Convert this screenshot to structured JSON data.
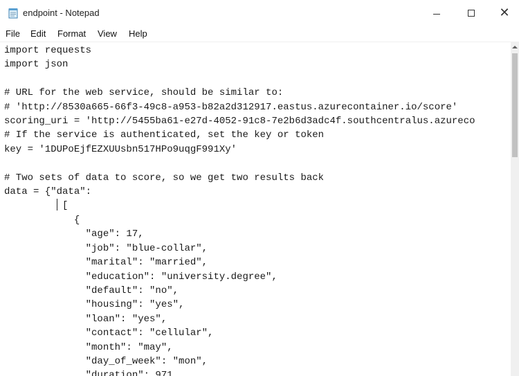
{
  "window": {
    "title": "endpoint - Notepad"
  },
  "menu": {
    "file": "File",
    "edit": "Edit",
    "format": "Format",
    "view": "View",
    "help": "Help"
  },
  "editor": {
    "lines": [
      "import requests",
      "import json",
      "",
      "# URL for the web service, should be similar to:",
      "# 'http://8530a665-66f3-49c8-a953-b82a2d312917.eastus.azurecontainer.io/score'",
      "scoring_uri = 'http://5455ba61-e27d-4052-91c8-7e2b6d3adc4f.southcentralus.azureco",
      "# If the service is authenticated, set the key or token",
      "key = '1DUPoEjfEZXUUsbn517HPo9uqgF991Xy'",
      "",
      "# Two sets of data to score, so we get two results back",
      "data = {\"data\":",
      "          [",
      "            {",
      "              \"age\": 17,",
      "              \"job\": \"blue-collar\",",
      "              \"marital\": \"married\",",
      "              \"education\": \"university.degree\",",
      "              \"default\": \"no\",",
      "              \"housing\": \"yes\",",
      "              \"loan\": \"yes\",",
      "              \"contact\": \"cellular\",",
      "              \"month\": \"may\",",
      "              \"day_of_week\": \"mon\",",
      "              \"duration\": 971,"
    ]
  },
  "icons": {
    "app": "notepad-icon",
    "minimize": "minimize-icon",
    "maximize": "maximize-icon",
    "close": "close-icon",
    "scroll_up": "chevron-up-icon"
  }
}
